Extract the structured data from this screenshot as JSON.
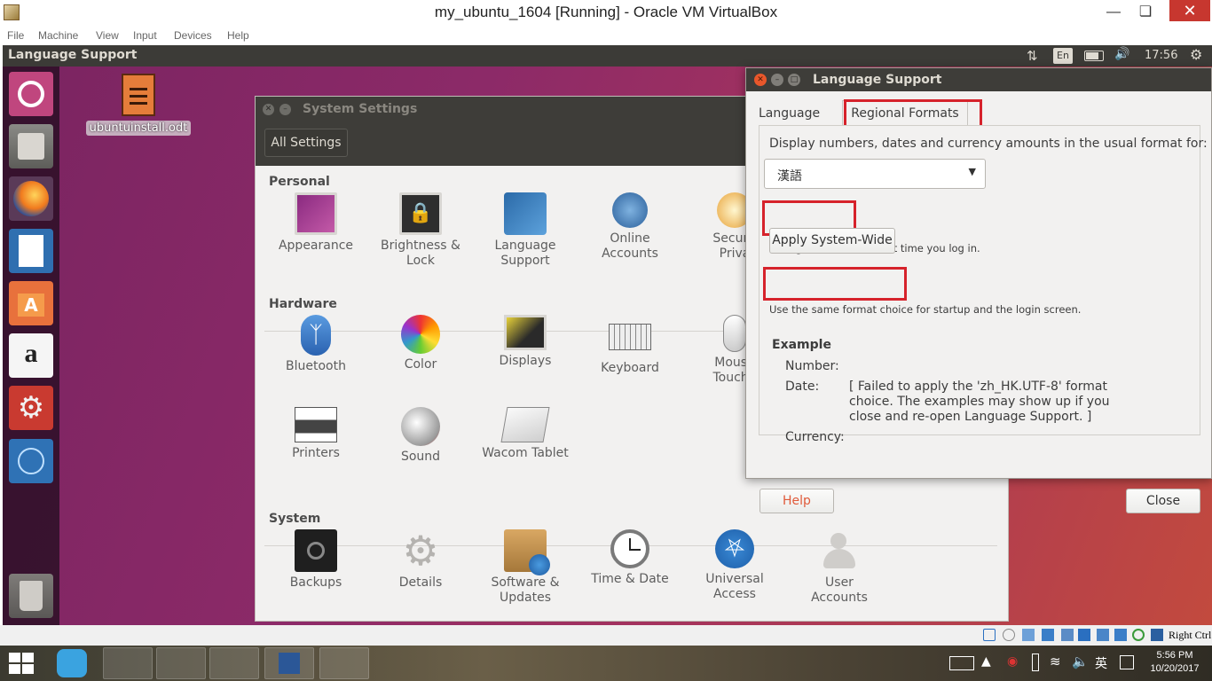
{
  "host_window": {
    "title": "my_ubuntu_1604 [Running] - Oracle VM VirtualBox",
    "menu": [
      "File",
      "Machine",
      "View",
      "Input",
      "Devices",
      "Help"
    ],
    "status_right": "Right Ctrl"
  },
  "ubuntu_topbar": {
    "title": "Language Support",
    "input_method": "En",
    "time": "17:56"
  },
  "desktop": {
    "file_name": "ubuntuinstall.odt"
  },
  "system_settings": {
    "title": "System Settings",
    "all_settings_label": "All Settings",
    "sections": {
      "personal": "Personal",
      "hardware": "Hardware",
      "system": "System"
    },
    "personal_items": [
      [
        "Appearance",
        ""
      ],
      [
        "Brightness &",
        "Lock"
      ],
      [
        "Language",
        "Support"
      ],
      [
        "Online",
        "Accounts"
      ],
      [
        "Securit",
        "Priva"
      ]
    ],
    "hardware_items": [
      [
        "Bluetooth",
        ""
      ],
      [
        "Color",
        ""
      ],
      [
        "Displays",
        ""
      ],
      [
        "Keyboard",
        ""
      ],
      [
        "Mouse",
        "Touchp"
      ],
      [
        "Printers",
        ""
      ],
      [
        "Sound",
        ""
      ],
      [
        "Wacom Tablet",
        ""
      ]
    ],
    "system_items": [
      [
        "Backups",
        ""
      ],
      [
        "Details",
        ""
      ],
      [
        "Software &",
        "Updates"
      ],
      [
        "Time & Date",
        ""
      ],
      [
        "Universal",
        "Access"
      ],
      [
        "User",
        "Accounts"
      ]
    ]
  },
  "language_support": {
    "title": "Language Support",
    "tab_language": "Language",
    "tab_regional": "Regional Formats",
    "description": "Display numbers, dates and currency amounts in the usual format for:",
    "selected_format": "漢語",
    "change_note": "Changes take effect next time you log in.",
    "apply_button": "Apply System-Wide",
    "apply_note": "Use the same format choice for startup and the login screen.",
    "example_heading": "Example",
    "number_label": "Number:",
    "date_label": "Date:",
    "date_value_1": "[ Failed to apply the 'zh_HK.UTF-8' format",
    "date_value_2": "choice. The examples may show up if you",
    "date_value_3": "close and re-open Language Support. ]",
    "currency_label": "Currency:",
    "help_button": "Help",
    "close_button": "Close"
  },
  "windows_taskbar": {
    "time": "5:56 PM",
    "date": "10/20/2017",
    "ime": "英"
  },
  "colors": {
    "highlight_red": "#d6222b",
    "help_text": "#e05a3a",
    "ubuntu_panel": "#3c3b37"
  }
}
